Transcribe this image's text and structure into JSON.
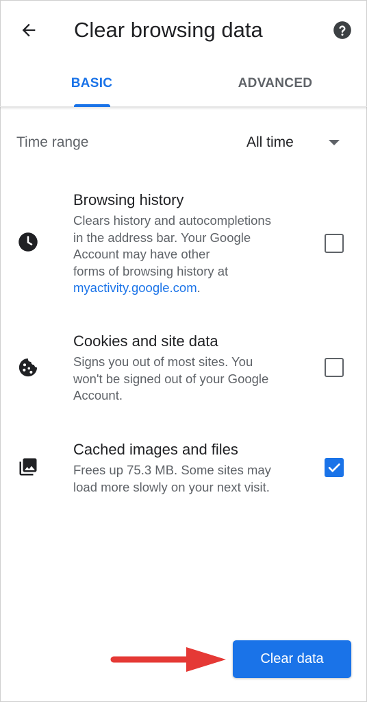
{
  "header": {
    "title": "Clear browsing data",
    "back_icon": "arrow-back-icon",
    "help_icon": "help-icon"
  },
  "tabs": [
    {
      "label": "BASIC",
      "selected": true
    },
    {
      "label": "ADVANCED",
      "selected": false
    }
  ],
  "time_range": {
    "label": "Time range",
    "value": "All time"
  },
  "items": [
    {
      "title": "Browsing history",
      "desc_lines": [
        "Clears history and autocompletions",
        "in the address bar. Your Google",
        "Account may have other",
        "forms of browsing history at"
      ],
      "link": "myactivity.google.com",
      "link_suffix": ".",
      "icon": "clock-icon",
      "checked": false
    },
    {
      "title": "Cookies and site data",
      "desc_lines": [
        "Signs you out of most sites. You",
        "won't be signed out of your Google",
        "Account."
      ],
      "icon": "cookie-icon",
      "checked": false
    },
    {
      "title": "Cached images and files",
      "desc_lines": [
        "Frees up 75.3 MB. Some sites may",
        "load more slowly on your next visit."
      ],
      "icon": "images-icon",
      "checked": true
    }
  ],
  "clear_button": {
    "label": "Clear data"
  },
  "colors": {
    "accent": "#1a73e8",
    "arrow": "#e53935",
    "text_primary": "#202124",
    "text_secondary": "#5f6368"
  }
}
